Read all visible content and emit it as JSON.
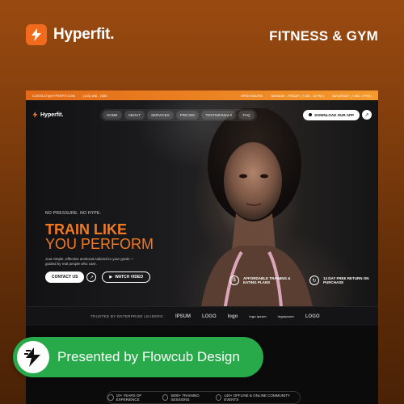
{
  "brand": {
    "name": "Hyperfit.",
    "tagline": "FITNESS & GYM"
  },
  "site": {
    "topbar": {
      "email": "CONTACT@HYPERFIT.COM",
      "phone": "(123) 456 - 7890",
      "hours_label": "OPEN HOURS:",
      "weekday": "MONDAY - FRIDAY ( 7 AM - 10 PM )",
      "weekend": "SATURDAY ( 7 AM - 9 PM )"
    },
    "nav": {
      "logo": "Hyperfit.",
      "items": [
        "HOME",
        "ABOUT",
        "SERVICES",
        "PRICING",
        "TESTIMONIALS",
        "FAQ"
      ],
      "download_label": "DOWNLOAD OUR APP"
    },
    "hero": {
      "eyebrow": "NO PRESSURE. NO HYPE.",
      "headline_1": "TRAIN LIKE",
      "headline_2": "YOU PERFORM",
      "subcopy": "Just simple, effective workouts tailored to your goals — guided by real people who care.",
      "contact_label": "CONTACT US",
      "video_label": "WATCH VIDEO"
    },
    "features": [
      {
        "icon": "dollar-icon",
        "text": "AFFORDABLE TRAINING & EATING PLANS"
      },
      {
        "icon": "refresh-icon",
        "text": "14 DAY FREE RETURN ON PURCHASE"
      }
    ],
    "trusted": {
      "label": "TRUSTED BY ENTERPRISE LEADERS:",
      "partners": [
        "IPSUM",
        "LOGO",
        "logo",
        "logo ipsum",
        "logoipsum",
        "LOGO"
      ]
    },
    "stats": [
      "10+ YEARS OF EXPERIENCE",
      "5000+ TRAINING SESSIONS",
      "140+ OFFLINE & ONLINE COMMUNITY EVENTS"
    ]
  },
  "badge": {
    "text": "Presented by Flowcub Design"
  },
  "colors": {
    "accent": "#f07a22",
    "badge": "#28a94a",
    "background": "#7a3a0c"
  }
}
